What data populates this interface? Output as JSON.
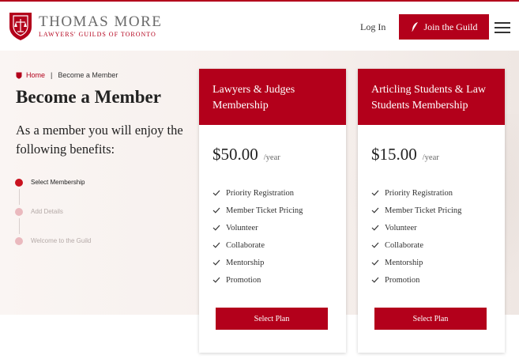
{
  "header": {
    "brand_name": "THOMAS MORE",
    "brand_sub": "LAWYERS' GUILDS OF TORONTO",
    "login_label": "Log In",
    "join_label": "Join the Guild",
    "crest_icon": "shield-crest-icon",
    "menu_icon": "hamburger-menu-icon"
  },
  "breadcrumb": {
    "home": "Home",
    "separator": "|",
    "current": "Become a Member"
  },
  "page": {
    "title": "Become a Member",
    "intro": "As a member you will enjoy the following benefits:"
  },
  "steps": [
    {
      "label": "Select Membership",
      "active": true
    },
    {
      "label": "Add Details",
      "active": false
    },
    {
      "label": "Welcome to the Guild",
      "active": false
    }
  ],
  "plans": [
    {
      "title": "Lawyers & Judges Membership",
      "price": "$50.00",
      "period": "/year",
      "benefits": [
        "Priority Registration",
        "Member Ticket Pricing",
        "Volunteer",
        "Collaborate",
        "Mentorship",
        "Promotion"
      ],
      "button": "Select Plan"
    },
    {
      "title": "Articling Students & Law Students Membership",
      "price": "$15.00",
      "period": "/year",
      "benefits": [
        "Priority Registration",
        "Member Ticket Pricing",
        "Volunteer",
        "Collaborate",
        "Mentorship",
        "Promotion"
      ],
      "button": "Select Plan"
    }
  ],
  "colors": {
    "brand_red": "#b3001b",
    "step_active": "#c9121f",
    "step_inactive": "#eab9be"
  }
}
